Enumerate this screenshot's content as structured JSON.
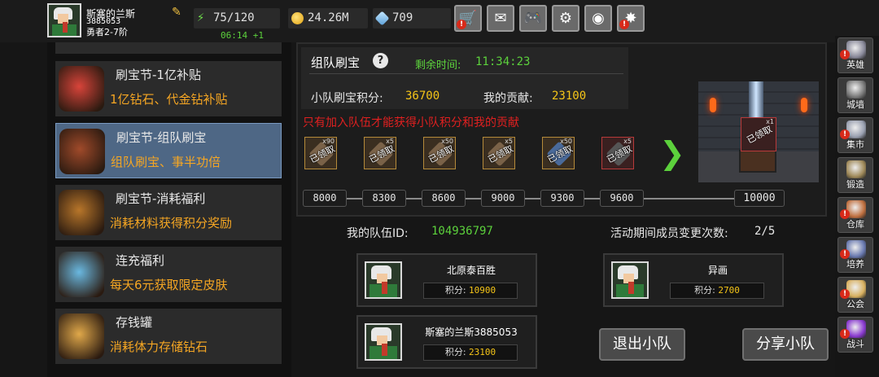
{
  "player": {
    "name": "斯塞的兰斯",
    "id": "3885053",
    "rank": "勇者2-7阶"
  },
  "resources": {
    "energy": "75/120",
    "energy_timer": "06:14 +1",
    "gold": "24.26M",
    "gems": "709"
  },
  "top_buttons": [
    {
      "name": "shop",
      "icon": "cart-icon",
      "glyph": "🛒",
      "badge": "!"
    },
    {
      "name": "mail",
      "icon": "mail-icon",
      "glyph": "✉",
      "badge": ""
    },
    {
      "name": "gamepad",
      "icon": "gamepad-icon",
      "glyph": "🎮",
      "badge": ""
    },
    {
      "name": "settings",
      "icon": "gear-icon",
      "glyph": "⚙",
      "badge": ""
    },
    {
      "name": "wheel",
      "icon": "color-wheel-icon",
      "glyph": "◉",
      "badge": ""
    },
    {
      "name": "event",
      "icon": "burst-icon",
      "glyph": "✸",
      "badge": "!"
    }
  ],
  "events": [
    {
      "title": "刷宝节-1亿补贴",
      "desc": "1亿钻石、代金钻补贴",
      "icon": "flower-icon",
      "color": "#d8443a",
      "active": false
    },
    {
      "title": "刷宝节-组队刷宝",
      "desc": "组队刷宝、事半功倍",
      "icon": "treasure-chest-icon",
      "color": "#a04a2a",
      "active": true
    },
    {
      "title": "刷宝节-消耗福利",
      "desc": "消耗材料获得积分奖励",
      "icon": "open-chest-icon",
      "color": "#b8762a",
      "active": false
    },
    {
      "title": "连充福利",
      "desc": "每天6元获取限定皮肤",
      "icon": "crystal-icon",
      "color": "#6ab8e0",
      "active": false
    },
    {
      "title": "存钱罐",
      "desc": "消耗体力存储钻石",
      "icon": "piggy-bank-icon",
      "color": "#e0a84a",
      "active": false
    }
  ],
  "team_panel": {
    "title": "组队刷宝",
    "time_label": "剩余时间:",
    "time_value": "11:34:23",
    "score_label": "小队刷宝积分:",
    "score_value": "36700",
    "contrib_label": "我的贡献:",
    "contrib_value": "23100",
    "warning": "只有加入队伍才能获得小队积分和我的贡献",
    "claimed_text": "已领取",
    "rewards": [
      {
        "qty": "x90",
        "icon": "scroll-icon",
        "frame": "gold"
      },
      {
        "qty": "x5",
        "icon": "hammer-icon",
        "frame": "gold"
      },
      {
        "qty": "x50",
        "icon": "hammer-icon",
        "frame": "gold"
      },
      {
        "qty": "x5",
        "icon": "hammer-icon",
        "frame": "gold"
      },
      {
        "qty": "x50",
        "icon": "blue-hammer-icon",
        "frame": "gold"
      },
      {
        "qty": "x5",
        "icon": "dark-hammer-icon",
        "frame": "red"
      }
    ],
    "milestones": [
      "8000",
      "8300",
      "8600",
      "9000",
      "9300",
      "9600"
    ],
    "final_milestone": "10000",
    "final_reward_qty": "x1"
  },
  "team": {
    "id_label": "我的队伍ID:",
    "id_value": "104936797",
    "changes_label": "活动期间成员变更次数:",
    "changes_value": "2/5",
    "score_prefix": "积分:",
    "members": [
      {
        "name": "北原泰百胜",
        "score": "10900"
      },
      {
        "name": "异画",
        "score": "2700"
      },
      {
        "name": "斯塞的兰斯3885053",
        "score": "23100"
      }
    ],
    "leave_button": "退出小队",
    "share_button": "分享小队"
  },
  "sidebar": [
    {
      "label": "英雄",
      "icon": "helmet-icon",
      "color": "#8a8a9a",
      "badge": "!"
    },
    {
      "label": "城墙",
      "icon": "wall-icon",
      "color": "#7a7a7a",
      "badge": ""
    },
    {
      "label": "集市",
      "icon": "market-icon",
      "color": "#9aa0b0",
      "badge": "!"
    },
    {
      "label": "锻造",
      "icon": "anvil-icon",
      "color": "#a08a5a",
      "badge": ""
    },
    {
      "label": "仓库",
      "icon": "warehouse-icon",
      "color": "#c07040",
      "badge": "!"
    },
    {
      "label": "培养",
      "icon": "training-icon",
      "color": "#6a7ab0",
      "badge": "!"
    },
    {
      "label": "公会",
      "icon": "guild-icon",
      "color": "#d8b060",
      "badge": "!"
    },
    {
      "label": "战斗",
      "icon": "portal-icon",
      "color": "#8a3ad0",
      "badge": "!"
    }
  ]
}
